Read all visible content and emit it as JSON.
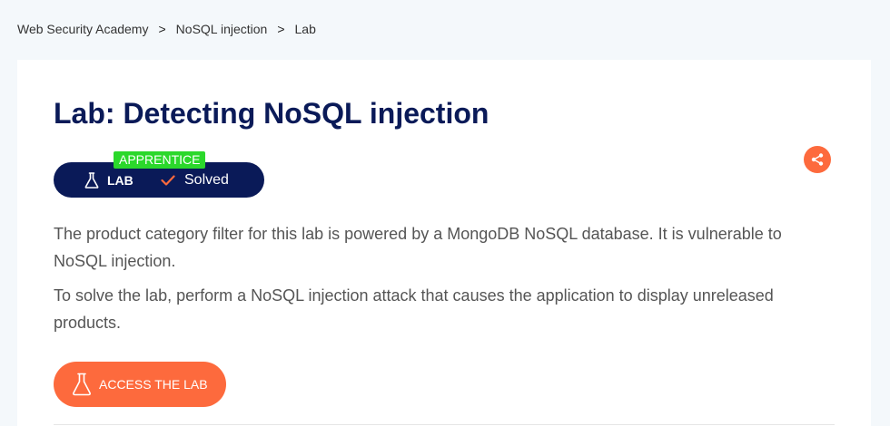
{
  "breadcrumb": {
    "items": [
      "Web Security Academy",
      "NoSQL injection",
      "Lab"
    ],
    "separator": ">"
  },
  "lab": {
    "title": "Lab: Detecting NoSQL injection",
    "level": "APPRENTICE",
    "type_label": "LAB",
    "status": "Solved",
    "description": [
      "The product category filter for this lab is powered by a MongoDB NoSQL database. It is vulnerable to NoSQL injection.",
      "To solve the lab, perform a NoSQL injection attack that causes the application to display unreleased products."
    ],
    "access_button_label": "ACCESS THE LAB"
  },
  "colors": {
    "navy": "#0a1a58",
    "orange": "#fd6a3d",
    "green": "#2bd82b",
    "background": "#f4f8fb"
  },
  "icons": {
    "lab": "flask-icon",
    "solved": "checkmark-icon",
    "share": "share-icon"
  }
}
